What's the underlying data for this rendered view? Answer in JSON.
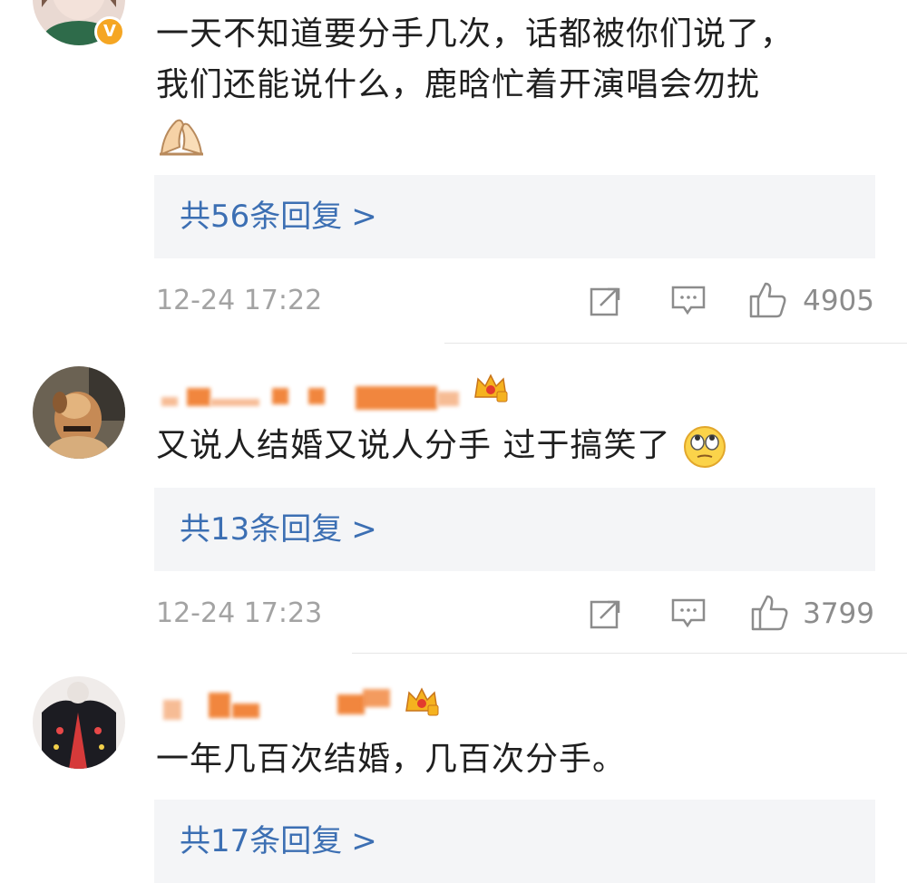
{
  "comments": [
    {
      "text_lines": [
        "一天不知道要分手几次，话都被你们说了，",
        "我们还能说什么，鹿晗忙着开演唱会勿扰"
      ],
      "emoji": "folded-hands-emoji",
      "replies_label": "共56条回复",
      "replies_arrow": ">",
      "time": "12-24 17:22",
      "likes": "4905",
      "verified_badge": "V"
    },
    {
      "text": "又说人结婚又说人分手 过于搞笑了",
      "emoji": "eye-roll-emoji",
      "replies_label": "共13条回复",
      "replies_arrow": ">",
      "time": "12-24 17:23",
      "likes": "3799"
    },
    {
      "text": "一年几百次结婚，几百次分手。",
      "replies_label": "共17条回复",
      "replies_arrow": ">"
    }
  ],
  "colors": {
    "link": "#3c6fb3",
    "meta": "#a3a3a3",
    "reply_bg": "#f4f5f7",
    "username_blur": "#f07a2a",
    "badge": "#f5a623"
  },
  "icons": [
    "repost-icon",
    "comment-icon",
    "like-icon",
    "crown-badge-icon"
  ]
}
